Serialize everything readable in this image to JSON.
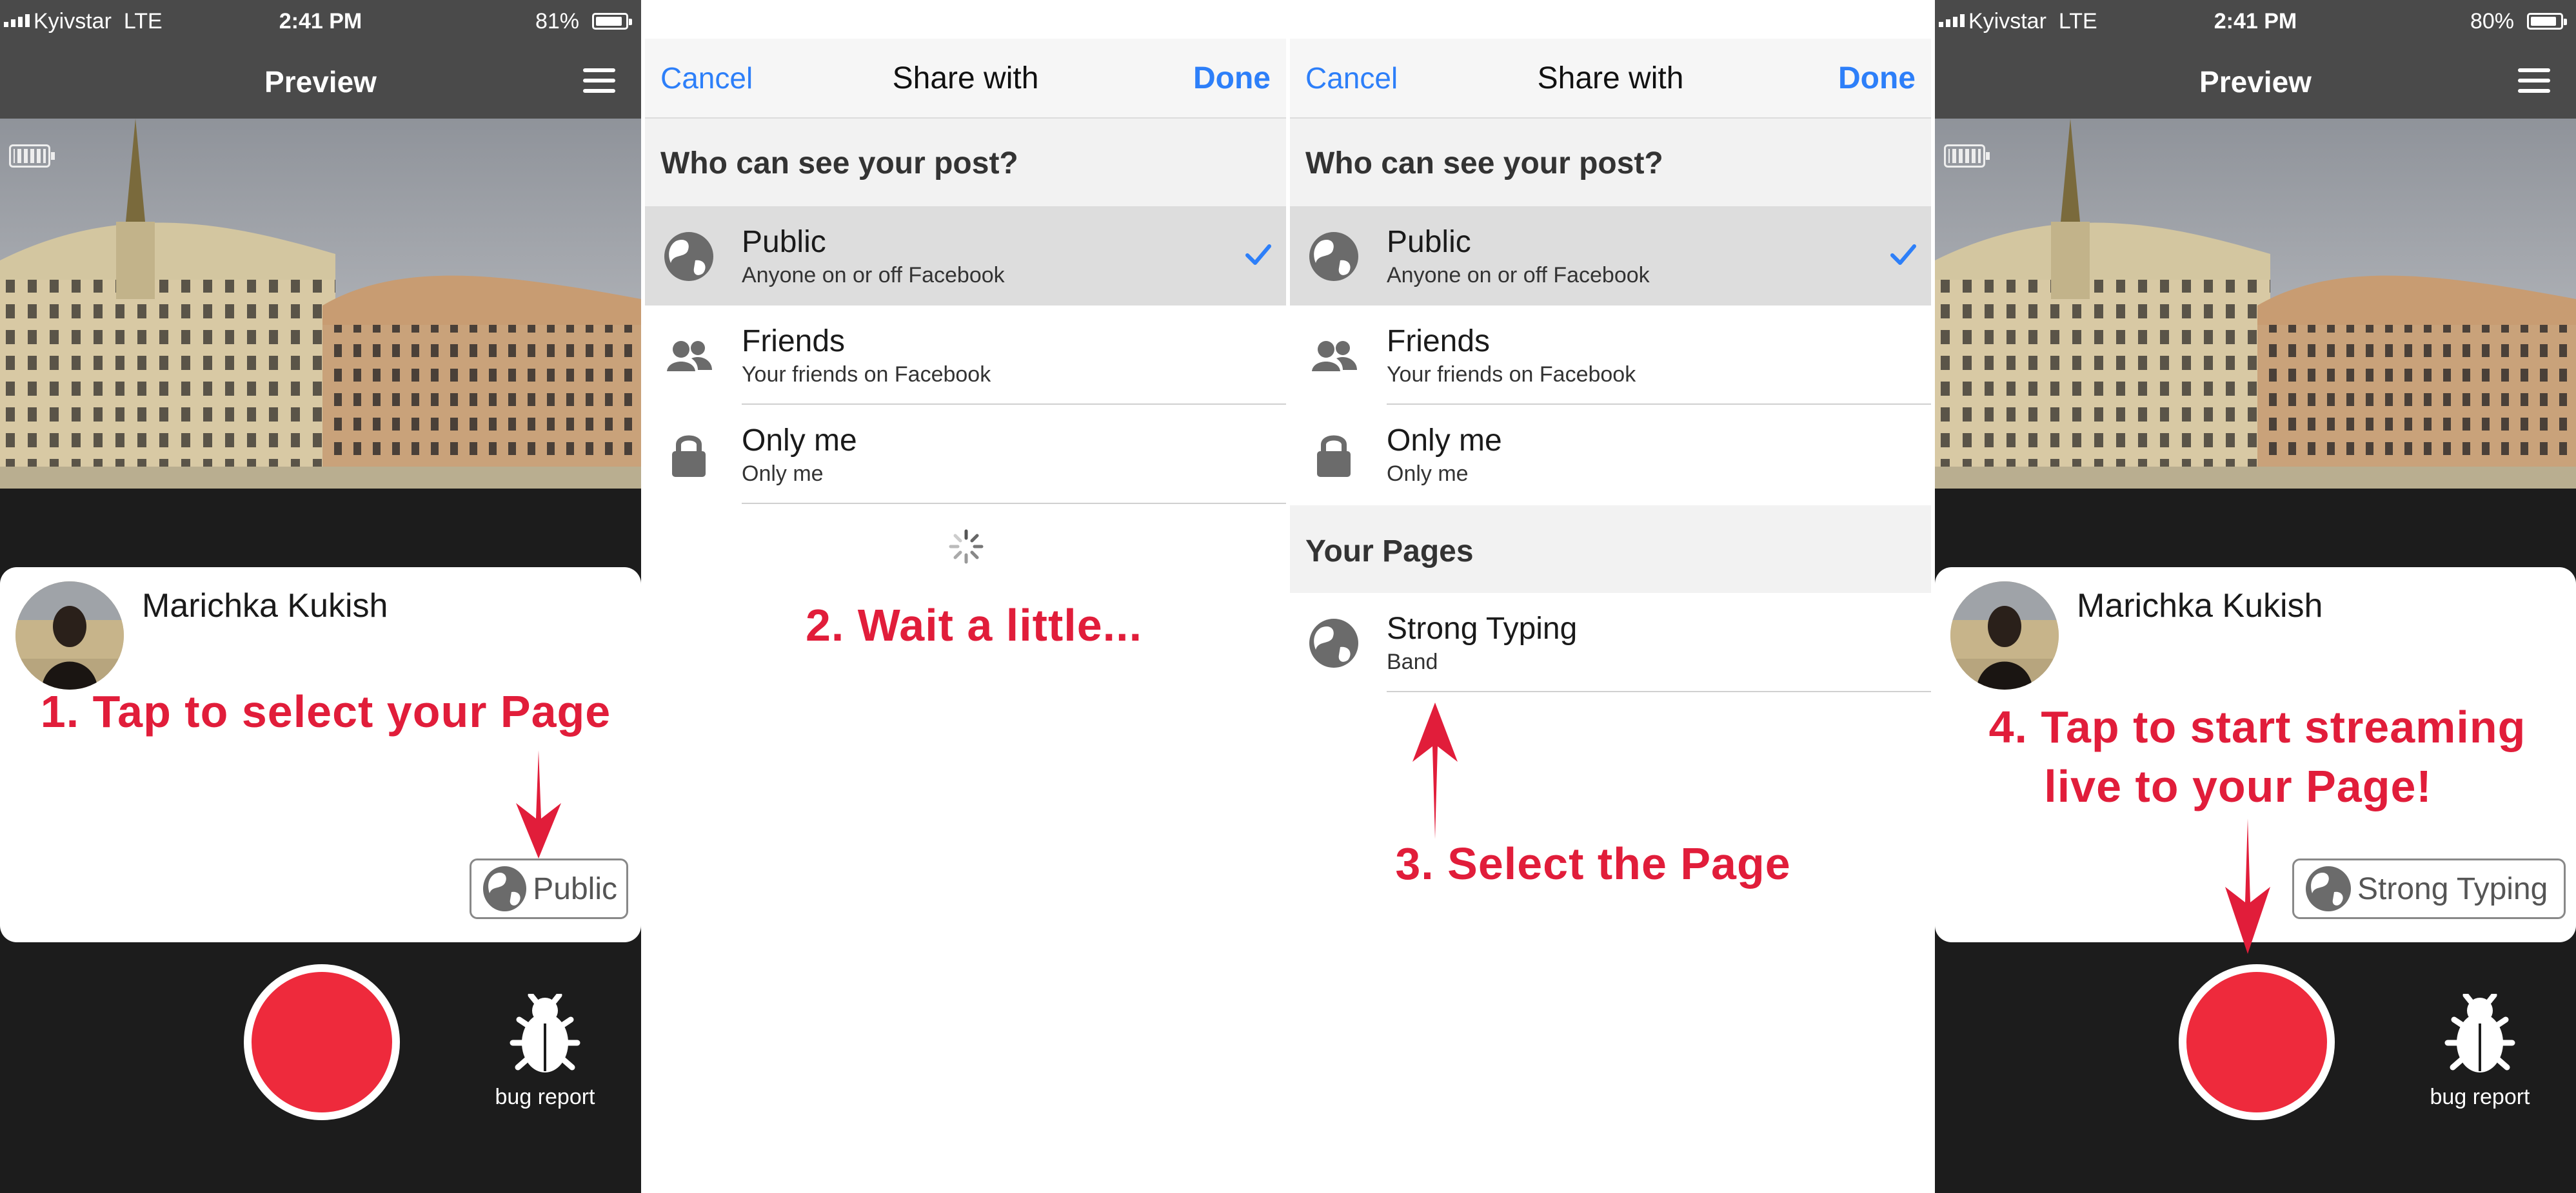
{
  "panels": {
    "preview1": {
      "status": {
        "carrier": "Kyivstar",
        "network": "LTE",
        "time": "2:41 PM",
        "battery": "81%"
      },
      "nav_title": "Preview",
      "user_name": "Marichka Kukish",
      "privacy_label": "Public",
      "bug_label": "bug report",
      "instruction": "1. Tap to select your Page"
    },
    "share1": {
      "cancel": "Cancel",
      "title": "Share with",
      "done": "Done",
      "question": "Who can see your post?",
      "options": [
        {
          "title": "Public",
          "subtitle": "Anyone on or off Facebook",
          "selected": true,
          "icon": "globe-icon"
        },
        {
          "title": "Friends",
          "subtitle": "Your friends on Facebook",
          "selected": false,
          "icon": "friends-icon"
        },
        {
          "title": "Only me",
          "subtitle": "Only me",
          "selected": false,
          "icon": "lock-icon"
        }
      ],
      "instruction": "2. Wait a little..."
    },
    "share2": {
      "cancel": "Cancel",
      "title": "Share with",
      "done": "Done",
      "question": "Who can see your post?",
      "options": [
        {
          "title": "Public",
          "subtitle": "Anyone on or off Facebook",
          "selected": true,
          "icon": "globe-icon"
        },
        {
          "title": "Friends",
          "subtitle": "Your friends on Facebook",
          "selected": false,
          "icon": "friends-icon"
        },
        {
          "title": "Only me",
          "subtitle": "Only me",
          "selected": false,
          "icon": "lock-icon"
        }
      ],
      "pages_header": "Your Pages",
      "pages": [
        {
          "title": "Strong Typing",
          "subtitle": "Band",
          "icon": "globe-icon"
        }
      ],
      "instruction": "3. Select the Page"
    },
    "preview2": {
      "status": {
        "carrier": "Kyivstar",
        "network": "LTE",
        "time": "2:41 PM",
        "battery": "80%"
      },
      "nav_title": "Preview",
      "user_name": "Marichka Kukish",
      "privacy_label": "Strong Typing",
      "bug_label": "bug report",
      "instruction_line1": "4. Tap to start streaming",
      "instruction_line2": "live to your Page!"
    }
  },
  "colors": {
    "accent_blue": "#2d7ff9",
    "record_red": "#ee2a3c",
    "instruction_red": "#e11d3a",
    "bar_gray": "#4a4a4a"
  }
}
